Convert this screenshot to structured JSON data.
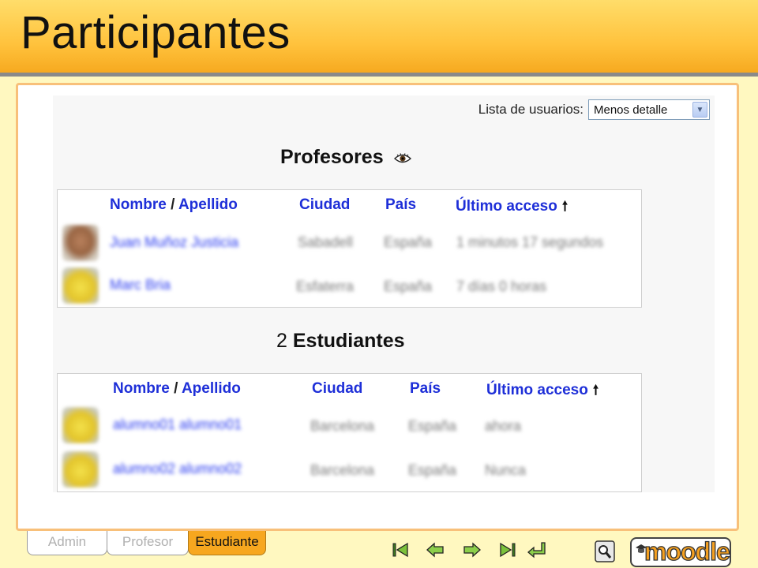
{
  "slide": {
    "title": "Participantes"
  },
  "list_control": {
    "label": "Lista de usuarios:",
    "selected": "Menos detalle"
  },
  "teachers": {
    "heading": "Profesores",
    "columns": {
      "name": "Nombre",
      "sep": "/",
      "surname": "Apellido",
      "city": "Ciudad",
      "country": "País",
      "last_access": "Último acceso"
    },
    "rows": [
      {
        "avatar": "photo",
        "name": "Juan Muñoz Justicia",
        "city": "Sabadell",
        "country": "España",
        "last": "1 minutos 17 segundos"
      },
      {
        "avatar": "default",
        "name": "Marc Bria",
        "city": "Esfaterra",
        "country": "España",
        "last": "7 días 0 horas"
      }
    ]
  },
  "students": {
    "count": "2",
    "heading": "Estudiantes",
    "columns": {
      "name": "Nombre",
      "sep": "/",
      "surname": "Apellido",
      "city": "Ciudad",
      "country": "País",
      "last_access": "Último acceso"
    },
    "rows": [
      {
        "avatar": "default",
        "name": "alumno01 alumno01",
        "city": "Barcelona",
        "country": "España",
        "last": "ahora"
      },
      {
        "avatar": "default",
        "name": "alumno02 alumno02",
        "city": "Barcelona",
        "country": "España",
        "last": "Nunca"
      }
    ]
  },
  "tabs": [
    {
      "label": "Admin",
      "active": false
    },
    {
      "label": "Profesor",
      "active": false
    },
    {
      "label": "Estudiante",
      "active": true
    }
  ],
  "logo": {
    "text": "moodle"
  },
  "icons": {
    "nav": [
      "first-slide-icon",
      "previous-slide-icon",
      "next-slide-icon",
      "last-slide-icon",
      "return-icon"
    ],
    "help": "magnifier-icon",
    "sort": "arrow-up-icon",
    "eye": "eye-icon"
  },
  "colors": {
    "link": "#1e2fd8",
    "header_top": "#ffdd6a",
    "header_bottom": "#f6a81e",
    "active_tab": "#f7a71f",
    "frame_border": "#f8c07a"
  }
}
